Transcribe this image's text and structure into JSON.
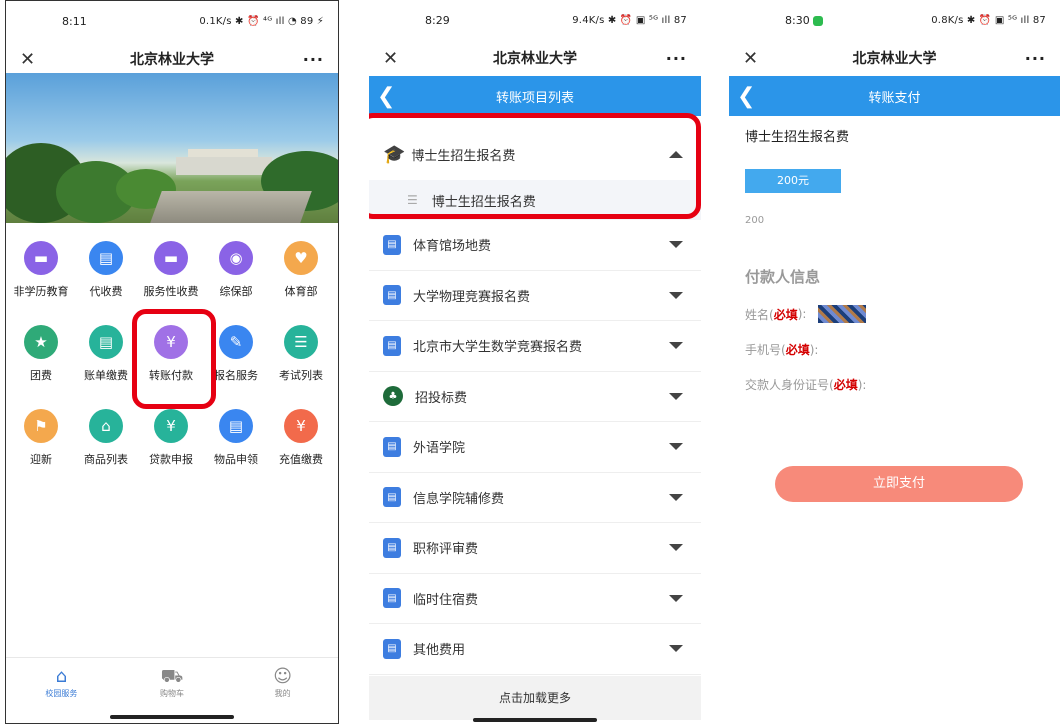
{
  "colors": {
    "accent": "#2b95e9",
    "highlight": "#e60012",
    "pay_button": "#f78a7a"
  },
  "phone1": {
    "status_time": "8:11",
    "status_right": "0.1K/s ✱ ⏰ ⁴ᴳ ıll ◔ 89 ⚡",
    "close": "✕",
    "title": "北京林业大学",
    "more": "···",
    "grid": [
      {
        "label": "非学历教育",
        "icon": "folder-icon",
        "glyph": "▬",
        "color": "#8a63e6"
      },
      {
        "label": "代收费",
        "icon": "document-icon",
        "glyph": "▤",
        "color": "#3a86f0"
      },
      {
        "label": "服务性收费",
        "icon": "folder-icon",
        "glyph": "▬",
        "color": "#8a63e6"
      },
      {
        "label": "综保部",
        "icon": "bag-icon",
        "glyph": "◉",
        "color": "#8a63e6"
      },
      {
        "label": "体育部",
        "icon": "heart-icon",
        "glyph": "♥",
        "color": "#f4a84d"
      },
      {
        "label": "团费",
        "icon": "star-icon",
        "glyph": "★",
        "color": "#2faa78"
      },
      {
        "label": "账单缴费",
        "icon": "bill-icon",
        "glyph": "▤",
        "color": "#27b39a"
      },
      {
        "label": "转账付款",
        "icon": "transfer-icon",
        "glyph": "¥",
        "color": "#a071e6"
      },
      {
        "label": "报名服务",
        "icon": "edit-icon",
        "glyph": "✎",
        "color": "#3a86f0"
      },
      {
        "label": "考试列表",
        "icon": "list-icon",
        "glyph": "☰",
        "color": "#27b39a"
      },
      {
        "label": "迎新",
        "icon": "signpost-icon",
        "glyph": "⚑",
        "color": "#f4a84d"
      },
      {
        "label": "商品列表",
        "icon": "shop-icon",
        "glyph": "⌂",
        "color": "#27b39a"
      },
      {
        "label": "贷款申报",
        "icon": "moneybag-icon",
        "glyph": "¥",
        "color": "#27b39a"
      },
      {
        "label": "物品申领",
        "icon": "document-icon",
        "glyph": "▤",
        "color": "#3a86f0"
      },
      {
        "label": "充值缴费",
        "icon": "coin-icon",
        "glyph": "¥",
        "color": "#f26a4b"
      }
    ],
    "tabs": [
      {
        "label": "校园服务",
        "icon": "home-icon",
        "glyph": "⌂",
        "active": true
      },
      {
        "label": "购物车",
        "icon": "cart-icon",
        "glyph": "⛟",
        "active": false
      },
      {
        "label": "我的",
        "icon": "user-icon",
        "glyph": "☺",
        "active": false
      }
    ]
  },
  "phone2": {
    "status_time": "8:29",
    "status_right": "9.4K/s ✱ ⏰ ▣ ⁵ᴳ ıll 87",
    "close": "✕",
    "title": "北京林业大学",
    "more": "···",
    "back": "❮",
    "header": "转账项目列表",
    "expanded": {
      "label": "博士生招生报名费",
      "icon": "graduation-cap-icon",
      "glyph": "🎓",
      "sub": "博士生招生报名费"
    },
    "items": [
      {
        "label": "体育馆场地费"
      },
      {
        "label": "大学物理竞赛报名费"
      },
      {
        "label": "北京市大学生数学竞赛报名费"
      },
      {
        "label": "招投标费",
        "emblem": true
      },
      {
        "label": "外语学院"
      },
      {
        "label": "信息学院辅修费"
      },
      {
        "label": "职称评审费"
      },
      {
        "label": "临时住宿费"
      },
      {
        "label": "其他费用"
      }
    ],
    "load_more": "点击加载更多"
  },
  "phone3": {
    "status_time": "8:30",
    "status_right": "0.8K/s ✱ ⏰ ▣ ⁵ᴳ ıll 87",
    "close": "✕",
    "title": "北京林业大学",
    "more": "···",
    "back": "❮",
    "header": "转账支付",
    "item_title": "博士生招生报名费",
    "amount_button": "200元",
    "amount_value": "200",
    "section": "付款人信息",
    "name_label": "姓名(",
    "name_req": "必填",
    "name_end": "):",
    "phone_label": "手机号(",
    "phone_req": "必填",
    "phone_end": "):",
    "id_label": "交款人身份证号(",
    "id_req": "必填",
    "id_end": "):",
    "pay_button": "立即支付"
  }
}
